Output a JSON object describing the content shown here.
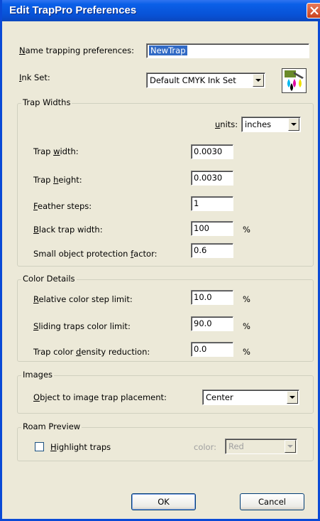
{
  "window": {
    "title": "Edit TrapPro Preferences"
  },
  "name_row": {
    "label_pre": "",
    "label_u": "N",
    "label_post": "ame trapping preferences:",
    "value": "NewTrap"
  },
  "inkset_row": {
    "label_pre": "",
    "label_u": "I",
    "label_post": "nk Set:",
    "value": "Default CMYK Ink Set",
    "icon": "ink-drops-icon"
  },
  "trap_widths": {
    "title": "Trap Widths",
    "units_label_u": "u",
    "units_label_post": "nits:",
    "units_value": "inches",
    "rows": [
      {
        "pre": "Trap ",
        "u": "w",
        "post": "idth:",
        "value": "0.0030",
        "suffix": ""
      },
      {
        "pre": "Trap ",
        "u": "h",
        "post": "eight:",
        "value": "0.0030",
        "suffix": ""
      },
      {
        "pre": "",
        "u": "F",
        "post": "eather steps:",
        "value": "1",
        "suffix": ""
      },
      {
        "pre": "",
        "u": "B",
        "post": "lack trap width:",
        "value": "100",
        "suffix": "%"
      },
      {
        "pre": "Small object protection ",
        "u": "f",
        "post": "actor:",
        "value": "0.6",
        "suffix": ""
      }
    ]
  },
  "color_details": {
    "title": "Color Details",
    "rows": [
      {
        "pre": "",
        "u": "R",
        "post": "elative color step limit:",
        "value": "10.0",
        "suffix": "%"
      },
      {
        "pre": "",
        "u": "S",
        "post": "liding traps color limit:",
        "value": "90.0",
        "suffix": "%"
      },
      {
        "pre": "Trap color ",
        "u": "d",
        "post": "ensity reduction:",
        "value": "0.0",
        "suffix": "%"
      }
    ]
  },
  "images": {
    "title": "Images",
    "label_pre": "",
    "label_u": "O",
    "label_post": "bject to image trap placement:",
    "value": "Center"
  },
  "roam_preview": {
    "title": "Roam Preview",
    "checkbox_pre": "",
    "checkbox_u": "H",
    "checkbox_post": "ighlight traps",
    "checked": false,
    "color_label": "color:",
    "color_value": "Red"
  },
  "buttons": {
    "ok": "OK",
    "cancel": "Cancel"
  },
  "colors": {
    "titlebar": "#0a5fe8",
    "face": "#ece9d8",
    "close": "#c9421c"
  }
}
